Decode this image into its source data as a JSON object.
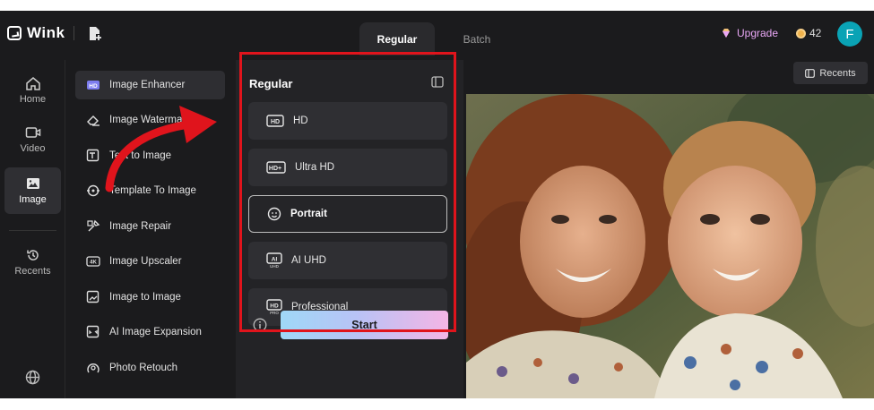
{
  "app": {
    "name": "Wink"
  },
  "tabs": [
    {
      "label": "Regular"
    },
    {
      "label": "Batch"
    }
  ],
  "header": {
    "upgrade_label": "Upgrade",
    "coins": "42",
    "avatar_letter": "F"
  },
  "rail": {
    "items": [
      {
        "label": "Home"
      },
      {
        "label": "Video"
      },
      {
        "label": "Image"
      },
      {
        "label": "Recents"
      }
    ]
  },
  "tools": [
    {
      "label": "Image Enhancer",
      "icon": "hd-badge-icon"
    },
    {
      "label": "Image Watermark Re...",
      "icon": "eraser-icon"
    },
    {
      "label": "Text to Image",
      "icon": "text-image-icon"
    },
    {
      "label": "Template To Image",
      "icon": "template-icon"
    },
    {
      "label": "Image Repair",
      "icon": "repair-icon"
    },
    {
      "label": "Image Upscaler",
      "icon": "4k-icon"
    },
    {
      "label": "Image to Image",
      "icon": "image-to-image-icon"
    },
    {
      "label": "AI Image Expansion",
      "icon": "expand-icon"
    },
    {
      "label": "Photo Retouch",
      "icon": "retouch-icon"
    }
  ],
  "panel": {
    "title": "Regular",
    "modes": [
      {
        "label": "HD",
        "icon": "hd-icon"
      },
      {
        "label": "Ultra HD",
        "icon": "hd-plus-icon"
      },
      {
        "label": "Portrait",
        "icon": "face-icon",
        "selected": true
      },
      {
        "label": "AI UHD",
        "icon": "ai-uhd-icon"
      },
      {
        "label": "Professional",
        "icon": "hd-pro-icon"
      }
    ],
    "start_label": "Start"
  },
  "preview": {
    "recents_label": "Recents"
  },
  "colors": {
    "highlight": "#e0141c",
    "arrow": "#e0141c",
    "accent_avatar": "#0aa3b5",
    "upgrade": "#e9a7f5"
  }
}
